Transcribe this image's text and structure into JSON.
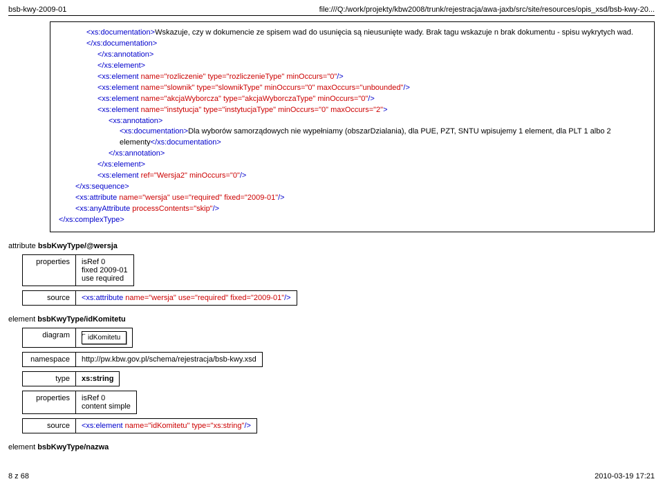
{
  "header": {
    "left": "bsb-kwy-2009-01",
    "right": "file:///Q:/work/projekty/kbw2008/trunk/rejestracja/awa-jaxb/src/site/resources/opis_xsd/bsb-kwy-20..."
  },
  "xml": {
    "docText1": "Wskazuje, czy w dokumencie ze spisem wad do usunięcia są nieusunięte wady. Brak tagu wskazuje n brak dokumentu - spisu wykrytych wad.",
    "docText2a": "Dla wyborów samorządowych nie wypełniamy (obszarDzialania), dla PUE, PZT, SNTU wpisujemy 1 element, dla PLT 1 albo 2 elementy",
    "tag": {
      "xsDoc": "<xs:documentation>",
      "xsDocEnd": "</xs:documentation>",
      "xsAnnEnd": "</xs:annotation>",
      "xsElEnd": "</xs:element>",
      "xsAnn": "<xs:annotation>",
      "xsSeqEnd": "</xs:sequence>",
      "xsCTEnd": "</xs:complexType>",
      "elRozPre": "<xs:element ",
      "elRozAttrs": "name=\"rozliczenie\" type=\"rozliczenieType\" minOccurs=\"0\"",
      "elRozSuf": "/>",
      "elSloAttrs": "name=\"slownik\" type=\"slownikType\" minOccurs=\"0\" maxOccurs=\"unbounded\"",
      "elAkcAttrs": "name=\"akcjaWyborcza\" type=\"akcjaWyborczaType\" minOccurs=\"0\"",
      "elInsAttrs": "name=\"instytucja\" type=\"instytucjaType\" minOccurs=\"0\" maxOccurs=\"2\"",
      "elRefPre": "<xs:element ",
      "elRefAttrs": "ref=\"Wersja2\" minOccurs=\"0\"",
      "attrPre": "<xs:attribute ",
      "attrAttrs": "name=\"wersja\" use=\"required\" fixed=\"2009-01\"",
      "anyPre": "<xs:anyAttribute ",
      "anyAttrs": "processContents=\"skip\"",
      "elIdKPre": "<xs:element ",
      "elIdKAttrs": "name=\"idKomitetu\" type=\"xs:string\""
    }
  },
  "sections": {
    "attrTitlePrefix": "attribute ",
    "attrTitleBold": "bsbKwyType/@wersja",
    "attrProps": {
      "label": "properties",
      "line1": "isRef 0",
      "line2": "fixed 2009-01",
      "line3": "use required"
    },
    "attrSourceLabel": "source",
    "el1TitlePrefix": "element ",
    "el1TitleBold": "bsbKwyType/idKomitetu",
    "el1DiagramLabel": "diagram",
    "el1DiagramBox": "idKomitetu",
    "el1NamespaceLabel": "namespace",
    "el1NamespaceVal": "http://pw.kbw.gov.pl/schema/rejestracja/bsb-kwy.xsd",
    "el1TypeLabel": "type",
    "el1TypeVal": "xs:string",
    "el1PropsLabel": "properties",
    "el1PropsLine1": "isRef 0",
    "el1PropsLine2": "content simple",
    "el1SourceLabel": "source",
    "el2TitlePrefix": "element ",
    "el2TitleBold": "bsbKwyType/nazwa"
  },
  "footer": {
    "left": "8 z 68",
    "right": "2010-03-19 17:21"
  }
}
